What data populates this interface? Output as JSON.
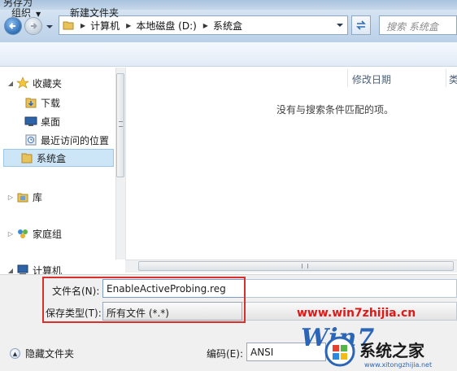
{
  "window": {
    "title": "另存为"
  },
  "address": {
    "crumbs": [
      "计算机",
      "本地磁盘 (D:)",
      "系统盒"
    ],
    "search_placeholder": "搜索 系统盒"
  },
  "toolbar": {
    "organize": "组织",
    "new_folder": "新建文件夹"
  },
  "nav": {
    "favorites": "收藏夹",
    "downloads": "下载",
    "desktop": "桌面",
    "recent": "最近访问的位置",
    "system_box": "系统盒",
    "libraries": "库",
    "homegroup": "家庭组",
    "computer": "计算机"
  },
  "content": {
    "col_date": "修改日期",
    "col_type": "类",
    "empty_message": "没有与搜索条件匹配的项。"
  },
  "form": {
    "filename_label": "文件名(N):",
    "filename_value": "EnableActiveProbing.reg",
    "type_label": "保存类型(T):",
    "type_value": "所有文件  (*.*)",
    "hide_folders": "隐藏文件夹",
    "encoding_label": "编码(E):",
    "encoding_value": "ANSI"
  },
  "watermark": {
    "url": "www.win7zhijia.cn",
    "win_text": "Win7",
    "brand": "系统之家",
    "sub": "www.xitongzhijia.net"
  },
  "colors": {
    "highlight": "#cde6f7",
    "redbox": "#d9302c",
    "watermark_red": "#e01818",
    "accent_blue": "#2b65b8"
  }
}
